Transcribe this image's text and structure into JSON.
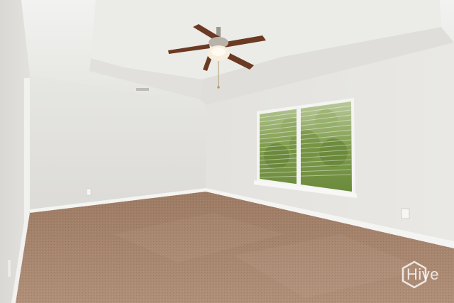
{
  "photo": {
    "subject": "empty-bedroom-with-ceiling-fan",
    "colors": {
      "wall": "#e4e3df",
      "wall_shadow": "#d6d5d1",
      "ceiling": "#eeeeec",
      "carpet": "#a88670",
      "baseboard": "#f4f4f2",
      "fan_blade": "#6b3a22",
      "window_foliage": "#7a9a4a"
    }
  },
  "watermark": {
    "text": "Hive"
  }
}
